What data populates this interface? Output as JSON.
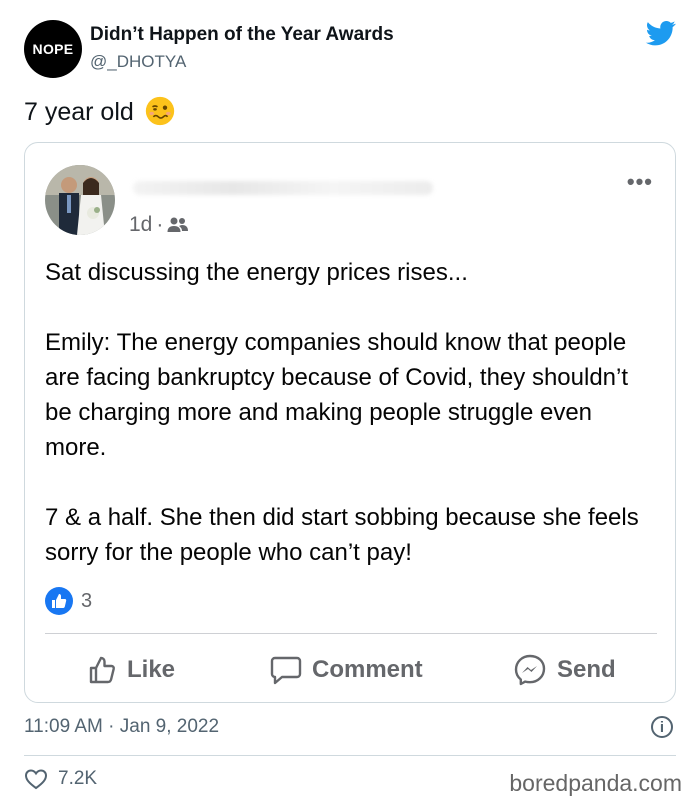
{
  "account": {
    "avatar_text": "NOPE",
    "name": "Didn’t Happen of the Year Awards",
    "handle": "@_DHOTYA"
  },
  "tweet": {
    "text": "7 year old",
    "emoji": "woozy-face-icon"
  },
  "embedded_post": {
    "time": "1d",
    "separator": "·",
    "menu": "•••",
    "body": "Sat discussing the energy prices rises...\n\nEmily: The energy companies should know that people are facing bankruptcy because of Covid, they shouldn’t be charging more and making people struggle even more.\n\n7 & a half. She then did start sobbing because she feels sorry for the people who can’t pay!",
    "reaction_count": "3",
    "actions": {
      "like": "Like",
      "comment": "Comment",
      "send": "Send"
    }
  },
  "footer": {
    "timestamp": "11:09 AM · Jan 9, 2022",
    "info": "i",
    "like_count": "7.2K",
    "watermark": "boredpanda.com"
  },
  "colors": {
    "twitter_blue": "#1d9bf0",
    "facebook_blue": "#1877f2",
    "muted": "#536471"
  }
}
